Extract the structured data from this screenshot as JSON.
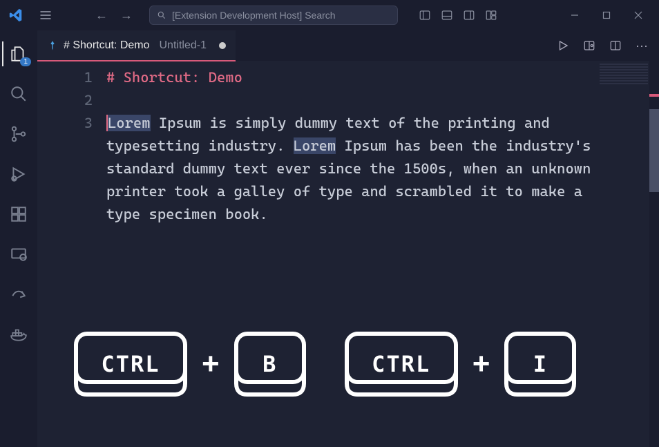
{
  "titlebar": {
    "search_placeholder": "[Extension Development Host] Search"
  },
  "activitybar": {
    "explorer_badge": "1"
  },
  "tab": {
    "title": "# Shortcut: Demo",
    "subtitle": "Untitled-1"
  },
  "editor": {
    "lines": {
      "l1": "1",
      "l2": "2",
      "l3": "3"
    },
    "heading": "# Shortcut: Demo",
    "para_sel1": "Lorem",
    "para_mid1": " Ipsum is simply dummy text of the printing and typesetting industry. ",
    "para_sel2": "Lorem",
    "para_rest": " Ipsum has been the industry's standard dummy text ever since the 1500s, when an unknown printer took a galley of type and scrambled it to make a type specimen book."
  },
  "keys": {
    "ctrl1": "CTRL",
    "b": "B",
    "ctrl2": "CTRL",
    "i": "I",
    "plus": "+"
  }
}
